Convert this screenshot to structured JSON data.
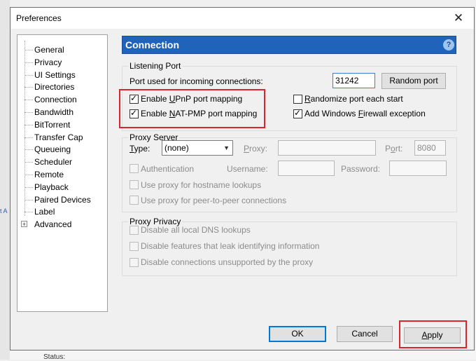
{
  "window": {
    "title": "Preferences",
    "close_glyph": "✕"
  },
  "tree": {
    "items": [
      {
        "label": "General"
      },
      {
        "label": "Privacy"
      },
      {
        "label": "UI Settings"
      },
      {
        "label": "Directories"
      },
      {
        "label": "Connection"
      },
      {
        "label": "Bandwidth"
      },
      {
        "label": "BitTorrent"
      },
      {
        "label": "Transfer Cap"
      },
      {
        "label": "Queueing"
      },
      {
        "label": "Scheduler"
      },
      {
        "label": "Remote"
      },
      {
        "label": "Playback"
      },
      {
        "label": "Paired Devices"
      },
      {
        "label": "Label"
      },
      {
        "label": "Advanced",
        "expander": "+"
      }
    ]
  },
  "panel": {
    "title": "Connection",
    "help_glyph": "?",
    "listening_port": {
      "group_title": "Listening Port",
      "port_label": "Port used for incoming connections:",
      "port_value": "31242",
      "random_port_button": "Random port",
      "upnp": {
        "pre": "Enable ",
        "key": "U",
        "post": "PnP port mapping",
        "checked": true
      },
      "natpmp": {
        "pre": "Enable ",
        "key": "N",
        "post": "AT-PMP port mapping",
        "checked": true
      },
      "randomize": {
        "pre": "",
        "key": "R",
        "post": "andomize port each start",
        "checked": false
      },
      "firewall": {
        "pre": "Add Windows ",
        "key": "F",
        "post": "irewall exception",
        "checked": true
      }
    },
    "proxy_server": {
      "group_title": "Proxy Server",
      "type_label": {
        "pre": "",
        "key": "T",
        "post": "ype:"
      },
      "type_value": "(none)",
      "proxy_label": {
        "pre": "",
        "key": "P",
        "post": "roxy:"
      },
      "proxy_value": "",
      "port_label": {
        "pre": "P",
        "key": "o",
        "post": "rt:"
      },
      "port_value": "8080",
      "authentication_label": "Authentication",
      "username_label": "Username:",
      "password_label": "Password:",
      "hostname_lookups_label": "Use proxy for hostname lookups",
      "p2p_label": "Use proxy for peer-to-peer connections"
    },
    "proxy_privacy": {
      "group_title": "Proxy Privacy",
      "dns_label": "Disable all local DNS lookups",
      "leak_label": "Disable features that leak identifying information",
      "unsupported_label": "Disable connections unsupported by the proxy"
    }
  },
  "footer": {
    "ok_button": "OK",
    "cancel_button": "Cancel",
    "apply_button": {
      "pre": "",
      "key": "A",
      "post": "pply"
    }
  },
  "background": {
    "side_text": "t A",
    "status_text": "Status:"
  },
  "colors": {
    "header_blue": "#1f63bb",
    "highlight_red": "#d9262c",
    "focus_blue": "#0078d7"
  }
}
